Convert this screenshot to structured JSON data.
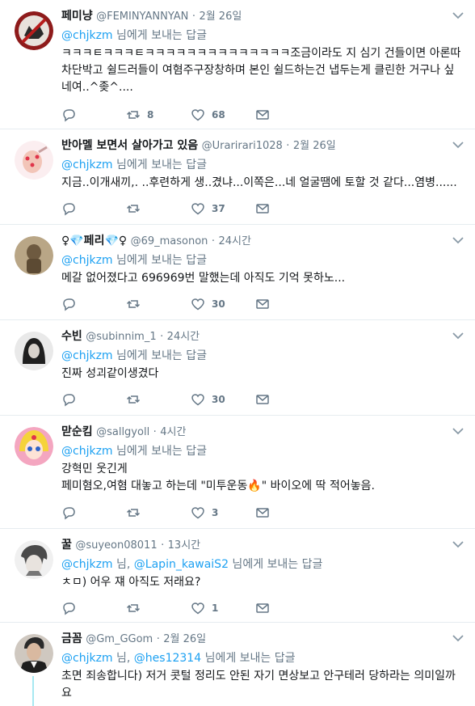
{
  "tweets": [
    {
      "name": "페미냥",
      "handle": "@FEMINYANNYAN",
      "dot": "·",
      "time": "2월 26일",
      "reply_mentions": [
        "@chjkzm"
      ],
      "reply_joiner": "",
      "reply_suffix": " 님에게 보내는 답글",
      "text": "ㅋㅋㅋㅌㅋㅋㅋㅌㅋㅋㅋㅋㅋㅋㅋㅋㅋㅋㅋㅋㅋㅋ조금이라도 지 심기 건들이면 아론따 차단박고 쉴드러들이 여혐주구장창하며 본인 쉴드하는건 냅두는게 클린한 거구나 싶네여..^좆^....",
      "reply_count": "",
      "retweet_count": "8",
      "like_count": "68",
      "avatar_color": "#c0392b"
    },
    {
      "name": "반아멜 보면서 살아가고 있음",
      "handle": "@Urarirari1028",
      "dot": "·",
      "time": "2월 26일",
      "reply_mentions": [
        "@chjkzm"
      ],
      "reply_joiner": "",
      "reply_suffix": " 님에게 보내는 답글",
      "text": "지금..이개새끼,. ..후련하게 생..겼냐...이쪽은...네 얼굴땜에 토할 것 같다...염병......",
      "reply_count": "",
      "retweet_count": "",
      "like_count": "37",
      "avatar_color": "#f5d5da"
    },
    {
      "name": "♀💎페리💎♀",
      "handle": "@69_masonon",
      "dot": "·",
      "time": "24시간",
      "reply_mentions": [
        "@chjkzm"
      ],
      "reply_joiner": "",
      "reply_suffix": " 님에게 보내는 답글",
      "text": "메갈 없어졌다고 696969번 말했는데 아직도 기억 못하노...",
      "reply_count": "",
      "retweet_count": "",
      "like_count": "30",
      "avatar_color": "#8a7356"
    },
    {
      "name": "수빈",
      "handle": "@subinnim_1",
      "dot": "·",
      "time": "24시간",
      "reply_mentions": [
        "@chjkzm"
      ],
      "reply_joiner": "",
      "reply_suffix": " 님에게 보내는 답글",
      "text": "진짜 성괴같이생겼다",
      "reply_count": "",
      "retweet_count": "",
      "like_count": "30",
      "avatar_color": "#2b2b2b"
    },
    {
      "name": "맏순킴",
      "handle": "@sallgyoll",
      "dot": "·",
      "time": "4시간",
      "reply_mentions": [
        "@chjkzm"
      ],
      "reply_joiner": "",
      "reply_suffix": " 님에게 보내는 답글",
      "text_lines": [
        "강혁민 웃긴게",
        "페미혐오,여혐 대놓고 하는데 \"미투운동🔥\" 바이오에 딱 적어놓음."
      ],
      "reply_count": "",
      "retweet_count": "",
      "like_count": "3",
      "avatar_color": "#f7c9d9"
    },
    {
      "name": "꿀",
      "handle": "@suyeon08011",
      "dot": "·",
      "time": "13시간",
      "reply_mentions": [
        "@chjkzm",
        "@Lapin_kawaiS2"
      ],
      "reply_joiner": " 님, ",
      "reply_suffix": " 님에게 보내는 답글",
      "text": "ㅊㅁ) 어우 쟤 아직도 저래요?",
      "reply_count": "",
      "retweet_count": "",
      "like_count": "1",
      "avatar_color": "#d9d9d9"
    },
    {
      "name": "금꼼",
      "handle": "@Gm_GGom",
      "dot": "·",
      "time": "2월 26일",
      "reply_mentions": [
        "@chjkzm",
        "@hes12314"
      ],
      "reply_joiner": " 님, ",
      "reply_suffix": " 님에게 보내는 답글",
      "text": "초면 죄송합니다) 저거 콧털 정리도 안된 자기 면상보고 안구테러 당하라는 의미일까요",
      "reply_count": "",
      "retweet_count": "",
      "like_count": "",
      "avatar_color": "#3a3a3a"
    }
  ],
  "icons": {
    "reply": "reply-icon",
    "retweet": "retweet-icon",
    "like": "heart-icon",
    "message": "envelope-icon",
    "more": "chevron-down-icon"
  },
  "colors": {
    "accent": "#1da1f2",
    "muted": "#657786",
    "text": "#14171a",
    "divider": "#e6ecf0",
    "thread": "#a7e8f1"
  }
}
